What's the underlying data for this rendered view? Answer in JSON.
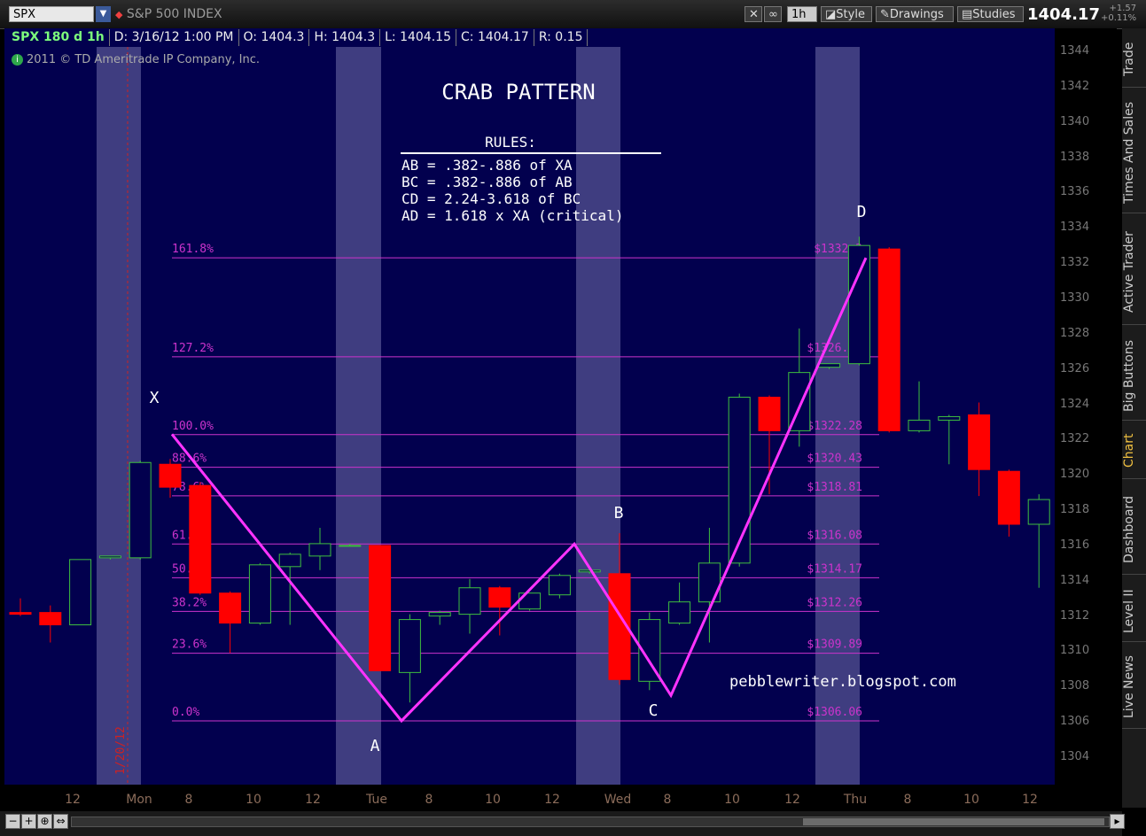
{
  "toolbar": {
    "symbol": "SPX",
    "index_name": "S&P 500 INDEX",
    "timeframe_label": "1h",
    "style_label": "Style",
    "drawings_label": "Drawings",
    "studies_label": "Studies",
    "last_price": "1404.17",
    "net_change": "+1.57",
    "pct_change": "+0.11%"
  },
  "info_bar": {
    "symbol_period": "SPX 180 d 1h",
    "date": "D: 3/16/12 1:00 PM",
    "open": "O: 1404.3",
    "high": "H: 1404.3",
    "low": "L: 1404.15",
    "close": "C: 1404.17",
    "range": "R: 0.15"
  },
  "copyright": "2011 © TD Ameritrade IP Company, Inc.",
  "sidebar_tabs": [
    "Trade",
    "Times And Sales",
    "Active Trader",
    "Big Buttons",
    "Chart",
    "Dashboard",
    "Level II",
    "Live News"
  ],
  "colors": {
    "chart_bg": "#02004e",
    "bull_candle": "#3fbf3f",
    "bear_candle": "#ff0000",
    "pattern_line": "#ff33ff",
    "fib_line": "#cc33cc",
    "shaded_band": "#3f3d80"
  },
  "chart_data": {
    "type": "candlestick",
    "title": "CRAB PATTERN",
    "rules_heading": "RULES:",
    "rules": [
      "AB = .382-.886 of XA",
      "BC = .382-.886 of AB",
      "CD = 2.24-3.618 of BC",
      "AD = 1.618 x XA (critical)"
    ],
    "watermark": "pebblewriter.blogspot.com",
    "ylim": [
      1302,
      1345
    ],
    "yticks": [
      1304,
      1306,
      1308,
      1310,
      1312,
      1314,
      1316,
      1318,
      1320,
      1322,
      1324,
      1326,
      1328,
      1330,
      1332,
      1334,
      1336,
      1338,
      1340,
      1342,
      1344
    ],
    "xticks": [
      "12",
      "Mon",
      "8",
      "10",
      "12",
      "Tue",
      "8",
      "10",
      "12",
      "Wed",
      "8",
      "10",
      "12",
      "Thu",
      "8",
      "10",
      "12"
    ],
    "date_marker": "1/20/12",
    "candles": [
      {
        "o": 1312.2,
        "h": 1313.0,
        "l": 1312.0,
        "c": 1312.1
      },
      {
        "o": 1312.2,
        "h": 1312.6,
        "l": 1310.5,
        "c": 1311.5
      },
      {
        "o": 1311.5,
        "h": 1315.2,
        "l": 1311.5,
        "c": 1315.2
      },
      {
        "o": 1315.3,
        "h": 1315.4,
        "l": 1315.2,
        "c": 1315.4
      },
      {
        "o": 1315.3,
        "h": 1320.8,
        "l": 1315.2,
        "c": 1320.7
      },
      {
        "o": 1320.6,
        "h": 1320.9,
        "l": 1318.7,
        "c": 1319.3
      },
      {
        "o": 1319.4,
        "h": 1319.6,
        "l": 1313.2,
        "c": 1313.3
      },
      {
        "o": 1313.3,
        "h": 1313.4,
        "l": 1309.9,
        "c": 1311.6
      },
      {
        "o": 1311.6,
        "h": 1315.0,
        "l": 1311.5,
        "c": 1314.9
      },
      {
        "o": 1314.8,
        "h": 1315.6,
        "l": 1311.5,
        "c": 1315.5
      },
      {
        "o": 1315.4,
        "h": 1317.0,
        "l": 1314.6,
        "c": 1316.1
      },
      {
        "o": 1316.0,
        "h": 1316.1,
        "l": 1316.0,
        "c": 1316.0
      },
      {
        "o": 1316.0,
        "h": 1316.0,
        "l": 1308.9,
        "c": 1308.9
      },
      {
        "o": 1308.8,
        "h": 1312.1,
        "l": 1307.1,
        "c": 1311.8
      },
      {
        "o": 1312.0,
        "h": 1312.3,
        "l": 1311.5,
        "c": 1312.2
      },
      {
        "o": 1312.1,
        "h": 1314.1,
        "l": 1311.0,
        "c": 1313.6
      },
      {
        "o": 1313.6,
        "h": 1313.7,
        "l": 1310.9,
        "c": 1312.5
      },
      {
        "o": 1312.4,
        "h": 1313.3,
        "l": 1312.3,
        "c": 1313.3
      },
      {
        "o": 1313.2,
        "h": 1314.4,
        "l": 1313.0,
        "c": 1314.3
      },
      {
        "o": 1314.5,
        "h": 1314.6,
        "l": 1314.4,
        "c": 1314.6
      },
      {
        "o": 1314.4,
        "h": 1316.7,
        "l": 1308.1,
        "c": 1308.4
      },
      {
        "o": 1308.3,
        "h": 1312.2,
        "l": 1307.8,
        "c": 1311.8
      },
      {
        "o": 1311.6,
        "h": 1313.9,
        "l": 1311.5,
        "c": 1312.8
      },
      {
        "o": 1312.8,
        "h": 1317.0,
        "l": 1310.5,
        "c": 1315.0
      },
      {
        "o": 1315.0,
        "h": 1324.6,
        "l": 1314.8,
        "c": 1324.4
      },
      {
        "o": 1324.4,
        "h": 1324.5,
        "l": 1318.9,
        "c": 1322.5
      },
      {
        "o": 1322.5,
        "h": 1328.3,
        "l": 1321.6,
        "c": 1325.8
      },
      {
        "o": 1326.1,
        "h": 1326.3,
        "l": 1326.0,
        "c": 1326.3
      },
      {
        "o": 1326.3,
        "h": 1333.5,
        "l": 1326.2,
        "c": 1333.0
      },
      {
        "o": 1332.8,
        "h": 1332.9,
        "l": 1322.4,
        "c": 1322.5
      },
      {
        "o": 1322.5,
        "h": 1325.3,
        "l": 1322.4,
        "c": 1323.1
      },
      {
        "o": 1323.1,
        "h": 1323.4,
        "l": 1320.6,
        "c": 1323.3
      },
      {
        "o": 1323.4,
        "h": 1324.1,
        "l": 1318.8,
        "c": 1320.3
      },
      {
        "o": 1320.2,
        "h": 1320.3,
        "l": 1316.5,
        "c": 1317.2
      },
      {
        "o": 1317.2,
        "h": 1318.9,
        "l": 1313.6,
        "c": 1318.6
      }
    ],
    "xabcd": [
      {
        "label": "X",
        "price": 1322.3
      },
      {
        "label": "A",
        "price": 1306.06
      },
      {
        "label": "B",
        "price": 1316.08
      },
      {
        "label": "C",
        "price": 1307.5
      },
      {
        "label": "D",
        "price": 1332.3
      }
    ],
    "fib_levels": [
      {
        "pct": "0.0%",
        "price": 1306.06,
        "label": "$1306.06"
      },
      {
        "pct": "23.6%",
        "price": 1309.89,
        "label": "$1309.89"
      },
      {
        "pct": "38.2%",
        "price": 1312.26,
        "label": "$1312.26"
      },
      {
        "pct": "50.0%",
        "price": 1314.17,
        "label": "$1314.17"
      },
      {
        "pct": "61.8%",
        "price": 1316.08,
        "label": "$1316.08"
      },
      {
        "pct": "78.6%",
        "price": 1318.81,
        "label": "$1318.81"
      },
      {
        "pct": "88.6%",
        "price": 1320.43,
        "label": "$1320.43"
      },
      {
        "pct": "100.0%",
        "price": 1322.28,
        "label": "$1322.28"
      },
      {
        "pct": "127.2%",
        "price": 1326.69,
        "label": "$1326.69"
      },
      {
        "pct": "161.8%",
        "price": 1332.3,
        "label": "$1332.3"
      }
    ]
  }
}
